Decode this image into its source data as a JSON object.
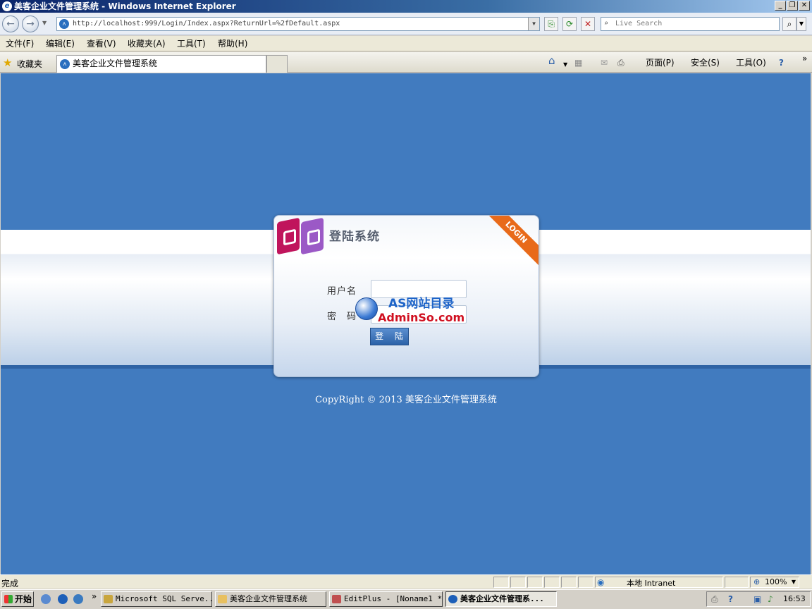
{
  "window": {
    "title": "美客企业文件管理系统 - Windows Internet Explorer"
  },
  "navigation": {
    "url": "http://localhost:999/Login/Index.aspx?ReturnUrl=%2fDefault.aspx",
    "search_placeholder": "Live Search"
  },
  "menu": [
    "文件(F)",
    "编辑(E)",
    "查看(V)",
    "收藏夹(A)",
    "工具(T)",
    "帮助(H)"
  ],
  "favorites": {
    "label": "收藏夹",
    "tab_title": "美客企业文件管理系统",
    "commands": {
      "page": "页面(P)",
      "safety": "安全(S)",
      "tools": "工具(O)"
    }
  },
  "login": {
    "title": "登陆系统",
    "ribbon": "LOGIN",
    "username_label": "用户名",
    "password_label": "密　码",
    "submit": "登 陆"
  },
  "watermark": {
    "line1": "AS网站目录",
    "line2": "AdminSo.com"
  },
  "footer": {
    "copyright": "CopyRight © 2013 美客企业文件管理系统"
  },
  "status_bar": {
    "text": "完成",
    "zone": "本地 Intranet",
    "zoom": "100%"
  },
  "taskbar": {
    "start": "开始",
    "tasks": [
      "Microsoft SQL Serve...",
      "美客企业文件管理系统",
      "EditPlus - [Noname1 *]",
      "美客企业文件管理系..."
    ],
    "clock": "16:53"
  }
}
